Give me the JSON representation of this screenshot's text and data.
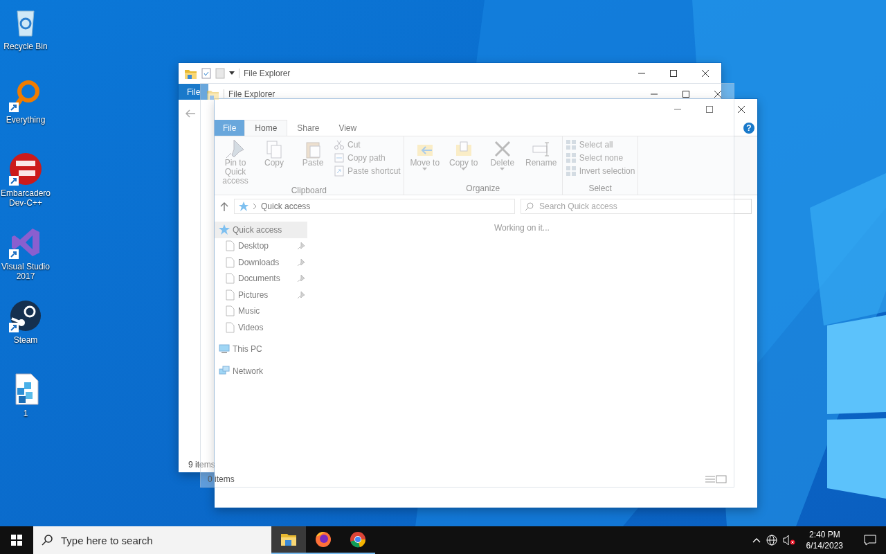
{
  "desktop": {
    "icons": [
      {
        "label": "Recycle Bin",
        "kind": "recycle",
        "shortcut": false
      },
      {
        "label": "Everything",
        "kind": "everything",
        "shortcut": true
      },
      {
        "label": "Embarcadero Dev-C++",
        "kind": "devcpp",
        "shortcut": true
      },
      {
        "label": "Visual Studio 2017",
        "kind": "vstudio",
        "shortcut": true
      },
      {
        "label": "Steam",
        "kind": "steam",
        "shortcut": true
      },
      {
        "label": "1",
        "kind": "registry",
        "shortcut": false
      }
    ]
  },
  "back_window": {
    "title": "File Explorer",
    "tabs": [
      {
        "label": "File",
        "kind": "file"
      }
    ],
    "status": "9 items"
  },
  "middle_window": {
    "title": "File Explorer",
    "message": "Working on it...",
    "status": "0 items"
  },
  "front_window": {
    "tabs": [
      {
        "label": "File",
        "kind": "file",
        "selected": false
      },
      {
        "label": "Home",
        "kind": "tab",
        "selected": true
      },
      {
        "label": "Share",
        "kind": "tab",
        "selected": false
      },
      {
        "label": "View",
        "kind": "tab",
        "selected": false
      }
    ],
    "help": "?",
    "ribbon": [
      {
        "label": "Clipboard",
        "commands": [
          {
            "label": "Pin to Quick access",
            "kind": "large",
            "dropdown": false
          },
          {
            "label": "Copy",
            "kind": "large",
            "dropdown": false
          },
          {
            "label": "Paste",
            "kind": "large",
            "dropdown": false
          },
          {
            "label": "Cut",
            "kind": "small",
            "dropdown": false
          },
          {
            "label": "Copy path",
            "kind": "small",
            "dropdown": false
          },
          {
            "label": "Paste shortcut",
            "kind": "small",
            "dropdown": false
          }
        ]
      },
      {
        "label": "Organize",
        "commands": [
          {
            "label": "Move to",
            "kind": "large",
            "dropdown": true
          },
          {
            "label": "Copy to",
            "kind": "large",
            "dropdown": true
          },
          {
            "label": "Delete",
            "kind": "large",
            "dropdown": true
          },
          {
            "label": "Rename",
            "kind": "large",
            "dropdown": false
          }
        ]
      },
      {
        "label": "Select",
        "commands": [
          {
            "label": "Select all",
            "kind": "small",
            "dropdown": false
          },
          {
            "label": "Select none",
            "kind": "small",
            "dropdown": false
          },
          {
            "label": "Invert selection",
            "kind": "small",
            "dropdown": false
          }
        ]
      }
    ],
    "address": {
      "location": "Quick access"
    },
    "search": {
      "placeholder": "Search Quick access"
    },
    "navigation": [
      {
        "label": "Quick access",
        "kind": "quick",
        "selected": true,
        "children": [
          {
            "label": "Desktop",
            "kind": "folder",
            "pinned": true,
            "selected": false
          },
          {
            "label": "Downloads",
            "kind": "folder",
            "pinned": true,
            "selected": false
          },
          {
            "label": "Documents",
            "kind": "folder",
            "pinned": true,
            "selected": false
          },
          {
            "label": "Pictures",
            "kind": "folder",
            "pinned": true,
            "selected": false
          },
          {
            "label": "Music",
            "kind": "folder",
            "pinned": false,
            "selected": false
          },
          {
            "label": "Videos",
            "kind": "folder",
            "pinned": false,
            "selected": false
          }
        ]
      },
      {
        "label": "This PC",
        "kind": "pc",
        "selected": false
      },
      {
        "label": "Network",
        "kind": "network",
        "selected": false
      }
    ]
  },
  "taskbar": {
    "search": {
      "placeholder": "Type here to search"
    },
    "apps": [
      {
        "kind": "explorer",
        "active": true
      },
      {
        "kind": "firefox",
        "active": false
      },
      {
        "kind": "chrome",
        "active": false
      }
    ],
    "time": "2:40 PM",
    "date": "6/14/2023"
  }
}
